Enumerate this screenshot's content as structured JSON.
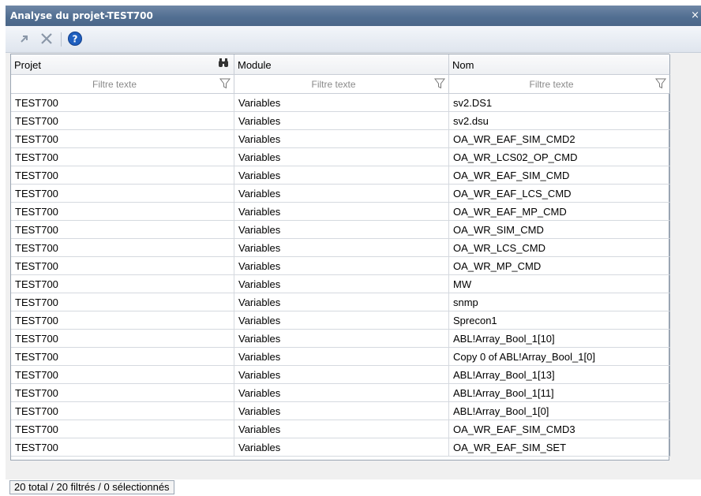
{
  "window": {
    "title": "Analyse du projet-TEST700",
    "close_glyph": "×"
  },
  "toolbar": {
    "buttons": [
      {
        "name": "navigate-icon",
        "color": "#8a97a8"
      },
      {
        "name": "delete-icon",
        "color": "#8a97a8"
      },
      {
        "name": "help-icon",
        "color": "#1f5fbf"
      }
    ]
  },
  "columns": [
    {
      "label": "Projet",
      "filter_placeholder": "Filtre texte",
      "has_find_icon": true
    },
    {
      "label": "Module",
      "filter_placeholder": "Filtre texte",
      "has_find_icon": false
    },
    {
      "label": "Nom",
      "filter_placeholder": "Filtre texte",
      "has_find_icon": false
    }
  ],
  "rows": [
    [
      "TEST700",
      "Variables",
      "sv2.DS1"
    ],
    [
      "TEST700",
      "Variables",
      "sv2.dsu"
    ],
    [
      "TEST700",
      "Variables",
      "OA_WR_EAF_SIM_CMD2"
    ],
    [
      "TEST700",
      "Variables",
      "OA_WR_LCS02_OP_CMD"
    ],
    [
      "TEST700",
      "Variables",
      "OA_WR_EAF_SIM_CMD"
    ],
    [
      "TEST700",
      "Variables",
      "OA_WR_EAF_LCS_CMD"
    ],
    [
      "TEST700",
      "Variables",
      "OA_WR_EAF_MP_CMD"
    ],
    [
      "TEST700",
      "Variables",
      "OA_WR_SIM_CMD"
    ],
    [
      "TEST700",
      "Variables",
      "OA_WR_LCS_CMD"
    ],
    [
      "TEST700",
      "Variables",
      "OA_WR_MP_CMD"
    ],
    [
      "TEST700",
      "Variables",
      "MW"
    ],
    [
      "TEST700",
      "Variables",
      "snmp"
    ],
    [
      "TEST700",
      "Variables",
      "Sprecon1"
    ],
    [
      "TEST700",
      "Variables",
      "ABL!Array_Bool_1[10]"
    ],
    [
      "TEST700",
      "Variables",
      "Copy 0 of ABL!Array_Bool_1[0]"
    ],
    [
      "TEST700",
      "Variables",
      "ABL!Array_Bool_1[13]"
    ],
    [
      "TEST700",
      "Variables",
      "ABL!Array_Bool_1[11]"
    ],
    [
      "TEST700",
      "Variables",
      "ABL!Array_Bool_1[0]"
    ],
    [
      "TEST700",
      "Variables",
      "OA_WR_EAF_SIM_CMD3"
    ],
    [
      "TEST700",
      "Variables",
      "OA_WR_EAF_SIM_SET"
    ]
  ],
  "status": {
    "text": "20 total / 20 filtrés / 0 sélectionnés"
  },
  "colors": {
    "titlebar": "#526f92",
    "grid_border": "#9aa5b3"
  }
}
